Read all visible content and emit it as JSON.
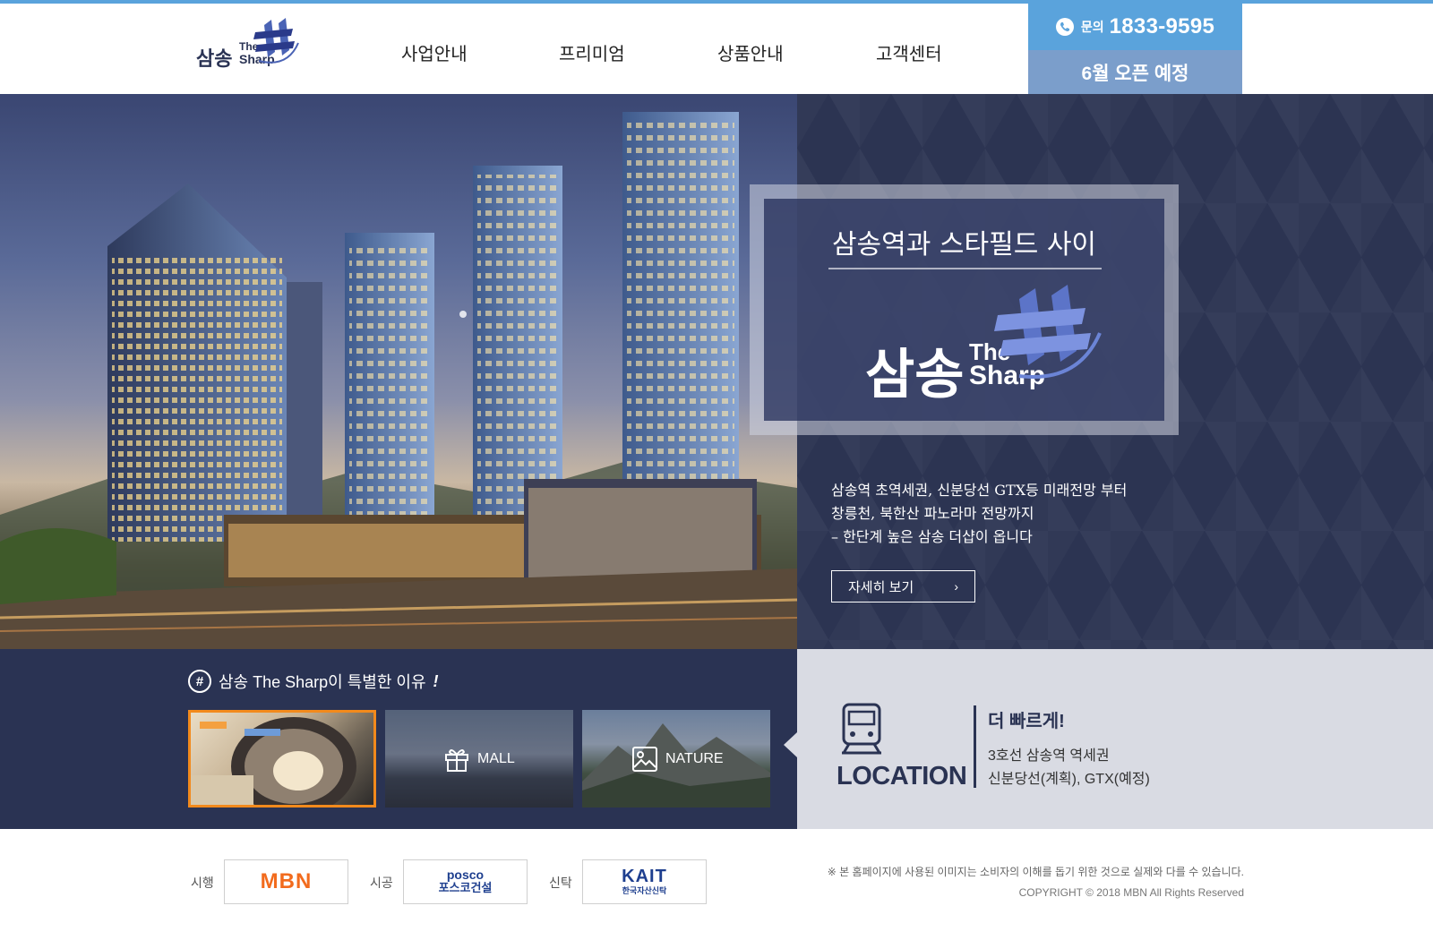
{
  "header": {
    "logo": {
      "korean": "삼송",
      "the": "The",
      "sharp": "Sharp"
    },
    "nav": [
      "사업안내",
      "프리미엄",
      "상품안내",
      "고객센터"
    ],
    "phone_label": "문의",
    "phone_number": "1833-9595",
    "open_notice": "6월 오픈 예정"
  },
  "hero": {
    "slogan": "삼송역과 스타필드 사이",
    "logo": {
      "korean": "삼송",
      "the": "The",
      "sharp": "Sharp"
    },
    "description": [
      "삼송역 초역세권, 신분당선 GTX등 미래전망 부터",
      "창릉천, 북한산 파노라마 전망까지",
      "– 한단계 높은 삼송 더샵이 옵니다"
    ],
    "more_button": "자세히 보기",
    "more_arrow": "›"
  },
  "reasons": {
    "title": "삼송 The Sharp이 특별한 이유",
    "title_mark": "!",
    "hash_icon": "#",
    "items": [
      {
        "label": "",
        "icon": "subway-photo"
      },
      {
        "label": "MALL",
        "icon": "gift-icon"
      },
      {
        "label": "NATURE",
        "icon": "image-icon"
      }
    ]
  },
  "location": {
    "title": "LOCATION",
    "headline": "더 빠르게!",
    "line1": "3호선 삼송역 역세권",
    "line2": "신분당선(계획), GTX(예정)"
  },
  "footer": {
    "partners": [
      {
        "role": "시행",
        "name": "MBN"
      },
      {
        "role": "시공",
        "name_en": "posco",
        "name_ko": "포스코건설"
      },
      {
        "role": "신탁",
        "name_en": "KAIT",
        "name_ko": "한국자산신탁"
      }
    ],
    "notice": "※ 본 홈페이지에 사용된 이미지는 소비자의 이해를 돕기 위한 것으로 실제와 다를 수 있습니다.",
    "copyright": "COPYRIGHT © 2018 MBN All Rights Reserved"
  },
  "colors": {
    "accent_blue": "#5aa3dc",
    "open_blue": "#7b9ecb",
    "navy": "#2a3353",
    "selected_border": "#f28a1c"
  }
}
